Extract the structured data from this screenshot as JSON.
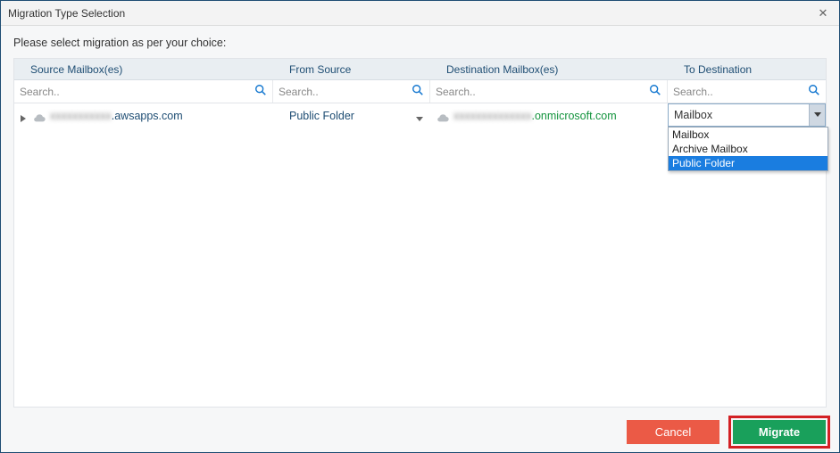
{
  "window": {
    "title": "Migration Type Selection",
    "prompt": "Please select migration as per your choice:"
  },
  "columns": [
    "Source Mailbox(es)",
    "From Source",
    "Destination Mailbox(es)",
    "To Destination"
  ],
  "search": {
    "placeholder": "Search.."
  },
  "row": {
    "source_obscured": "xxxxxxxxxxx",
    "source_visible": ".awsapps.com",
    "from_source": "Public Folder",
    "dest_obscured": "xxxxxxxxxxxxxx",
    "dest_visible": ".onmicrosoft.com",
    "to_destination_selected": "Mailbox",
    "to_destination_options": [
      "Mailbox",
      "Archive Mailbox",
      "Public Folder"
    ]
  },
  "buttons": {
    "cancel": "Cancel",
    "migrate": "Migrate"
  }
}
